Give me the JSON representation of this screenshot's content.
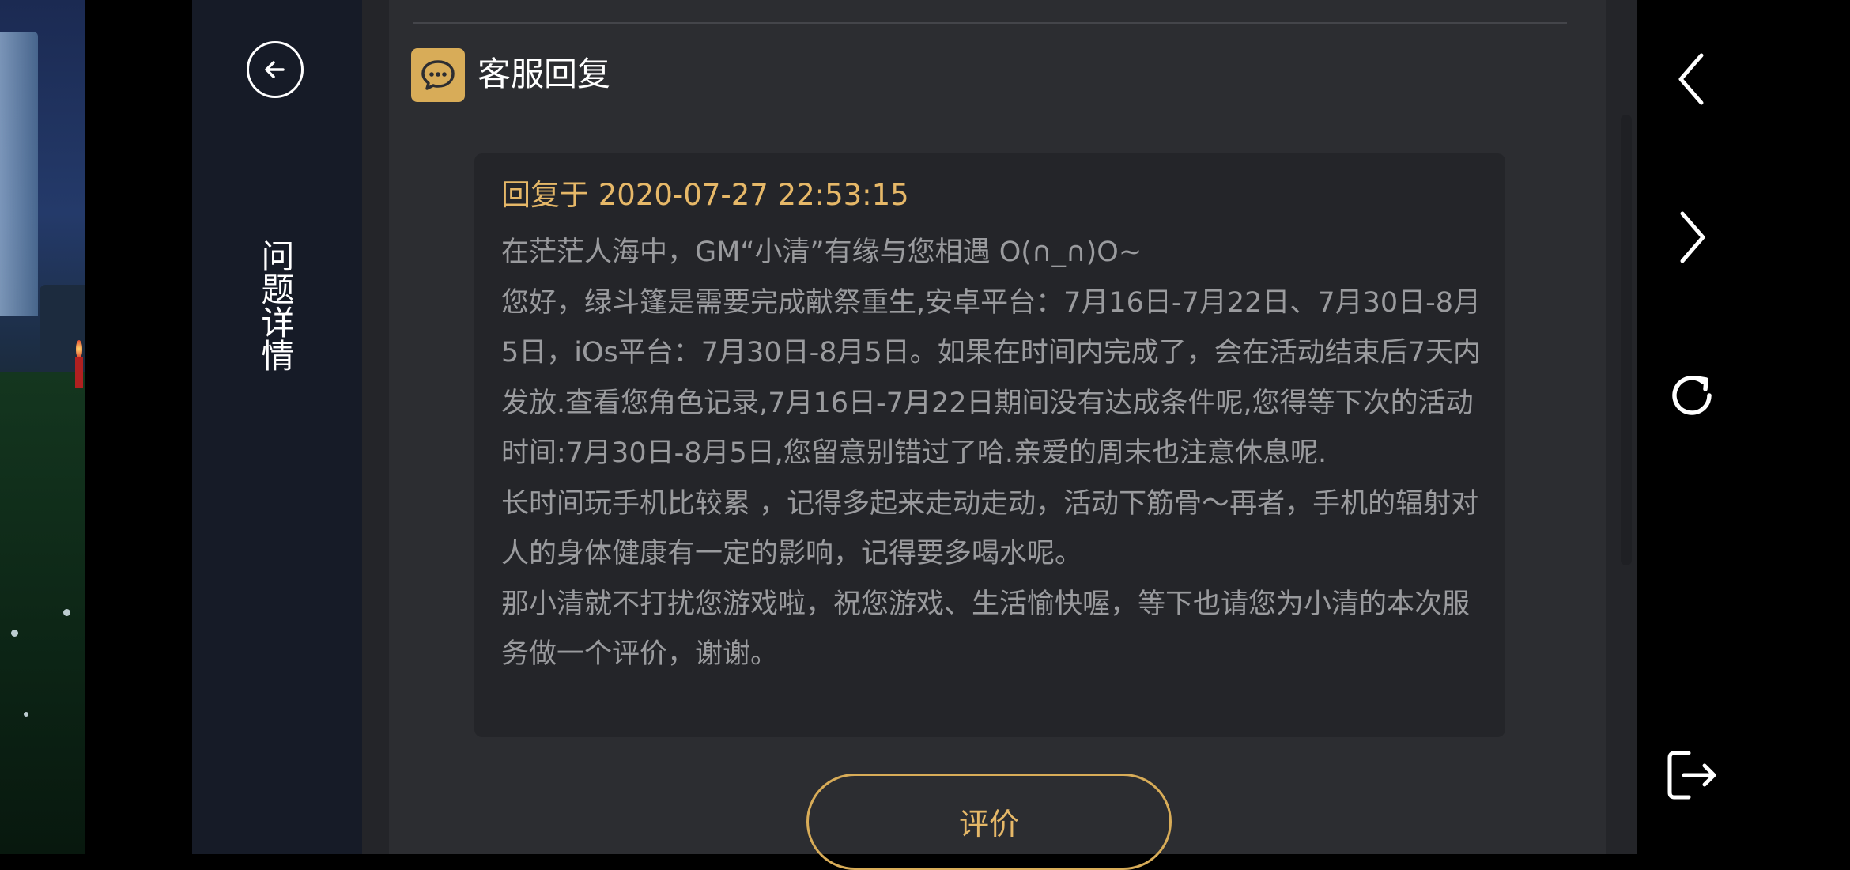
{
  "side_panel": {
    "title": "问题详情"
  },
  "reply_section": {
    "header": "客服回复",
    "timestamp": "回复于 2020-07-27 22:53:15",
    "paragraphs": [
      "在茫茫人海中，GM“小清”有缘与您相遇 O(∩_∩)O~",
      "您好，绿斗篷是需要完成献祭重生,安卓平台：7月16日-7月22日、7月30日-8月5日，iOs平台：7月30日-8月5日。如果在时间内完成了，会在活动结束后7天内发放.查看您角色记录,7月16日-7月22日期间没有达成条件呢,您得等下次的活动时间:7月30日-8月5日,您留意别错过了哈.亲爱的周末也注意休息呢.",
      "长时间玩手机比较累 ，记得多起来走动走动，活动下筋骨～再者，手机的辐射对人的身体健康有一定的影响，记得要多喝水呢。",
      "那小清就不打扰您游戏啦，祝您游戏、生活愉快喔，等下也请您为小清的本次服务做一个评价，谢谢。"
    ],
    "rate_button": "评价"
  },
  "icons": {
    "back": "back-circle-icon",
    "chat": "chat-bubble-icon",
    "nav_back": "chevron-left-icon",
    "nav_forward": "chevron-right-icon",
    "refresh": "refresh-icon",
    "exit": "exit-icon"
  },
  "colors": {
    "accent": "#d8ac58",
    "timestamp": "#e6b868",
    "body_text": "#9a9b9e",
    "panel": "#2c2d31"
  }
}
